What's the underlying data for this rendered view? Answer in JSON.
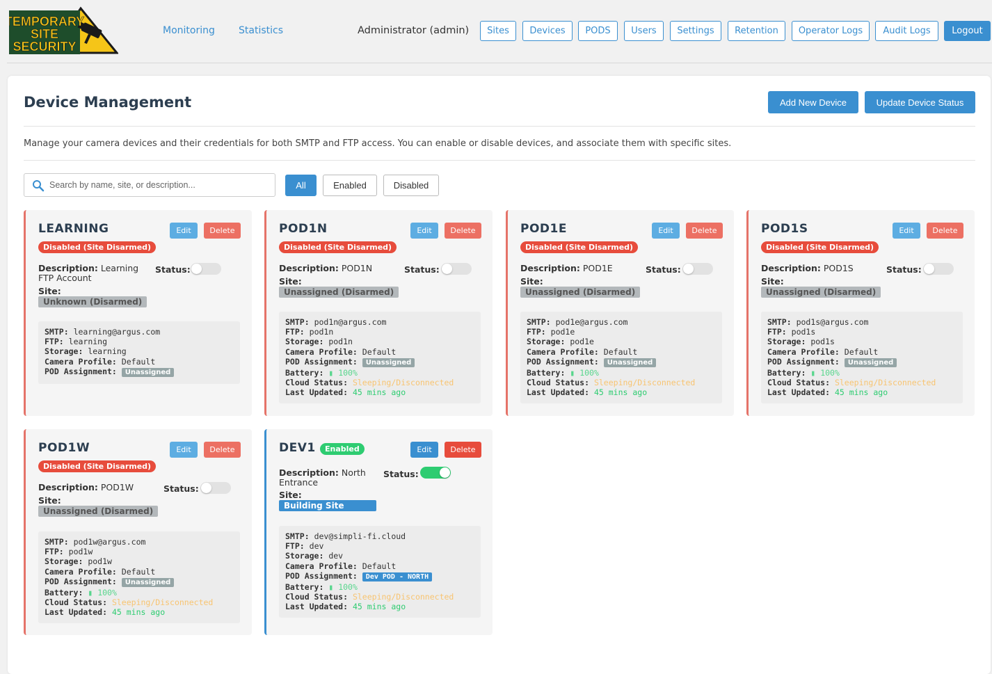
{
  "nav": {
    "logo_lines": [
      "TEMPORARY",
      "SITE",
      "SECURITY"
    ],
    "links": [
      "Monitoring",
      "Statistics"
    ],
    "user": "Administrator (admin)",
    "buttons": [
      "Sites",
      "Devices",
      "PODS",
      "Users",
      "Settings",
      "Retention",
      "Operator Logs",
      "Audit Logs"
    ],
    "logout": "Logout"
  },
  "page": {
    "title": "Device Management",
    "add_button": "Add New Device",
    "update_button": "Update Device Status",
    "description": "Manage your camera devices and their credentials for both SMTP and FTP access. You can enable or disable devices, and associate them with specific sites.",
    "search_placeholder": "Search by name, site, or description...",
    "filters": [
      "All",
      "Enabled",
      "Disabled"
    ]
  },
  "labels": {
    "edit": "Edit",
    "delete": "Delete",
    "description": "Description:",
    "status": "Status:",
    "site": "Site:",
    "smtp": "SMTP:",
    "ftp": "FTP:",
    "storage": "Storage:",
    "camera_profile": "Camera Profile:",
    "pod_assignment": "POD Assignment:",
    "battery": "Battery:",
    "cloud_status": "Cloud Status:",
    "last_updated": "Last Updated:"
  },
  "devices": [
    {
      "name": "LEARNING",
      "badge": "Disabled (Site Disarmed)",
      "desc1": "Learning",
      "desc2": "FTP Account",
      "site": "Unknown (Disarmed)",
      "smtp": "learning@argus.com",
      "ftp": "learning",
      "storage": "learning",
      "camera": "Default",
      "pod": "Unassigned"
    },
    {
      "name": "POD1N",
      "badge": "Disabled (Site Disarmed)",
      "desc1": "POD1N",
      "site": "Unassigned (Disarmed)",
      "smtp": "pod1n@argus.com",
      "ftp": "pod1n",
      "storage": "pod1n",
      "camera": "Default",
      "pod": "Unassigned",
      "battery": "100%",
      "cloud": "Sleeping/Disconnected",
      "updated": "45 mins ago"
    },
    {
      "name": "POD1E",
      "badge": "Disabled (Site Disarmed)",
      "desc1": "POD1E",
      "site": "Unassigned (Disarmed)",
      "smtp": "pod1e@argus.com",
      "ftp": "pod1e",
      "storage": "pod1e",
      "camera": "Default",
      "pod": "Unassigned",
      "battery": "100%",
      "cloud": "Sleeping/Disconnected",
      "updated": "45 mins ago"
    },
    {
      "name": "POD1S",
      "badge": "Disabled (Site Disarmed)",
      "desc1": "POD1S",
      "site": "Unassigned (Disarmed)",
      "smtp": "pod1s@argus.com",
      "ftp": "pod1s",
      "storage": "pod1s",
      "camera": "Default",
      "pod": "Unassigned",
      "battery": "100%",
      "cloud": "Sleeping/Disconnected",
      "updated": "45 mins ago"
    },
    {
      "name": "POD1W",
      "badge": "Disabled (Site Disarmed)",
      "desc1": "POD1W",
      "site": "Unassigned (Disarmed)",
      "smtp": "pod1w@argus.com",
      "ftp": "pod1w",
      "storage": "pod1w",
      "camera": "Default",
      "pod": "Unassigned",
      "battery": "100%",
      "cloud": "Sleeping/Disconnected",
      "updated": "45 mins ago"
    },
    {
      "name": "DEV1",
      "badge": "Enabled",
      "desc1": "North",
      "desc2": "Entrance",
      "site": "Building Site",
      "smtp": "dev@simpli-fi.cloud",
      "ftp": "dev",
      "storage": "dev",
      "camera": "Default",
      "pod": "Dev POD - NORTH",
      "battery": "100%",
      "cloud": "Sleeping/Disconnected",
      "updated": "45 mins ago"
    }
  ],
  "colors": {
    "accent": "#3a8fd0",
    "danger": "#e74c3c",
    "success": "#2ecc71"
  }
}
